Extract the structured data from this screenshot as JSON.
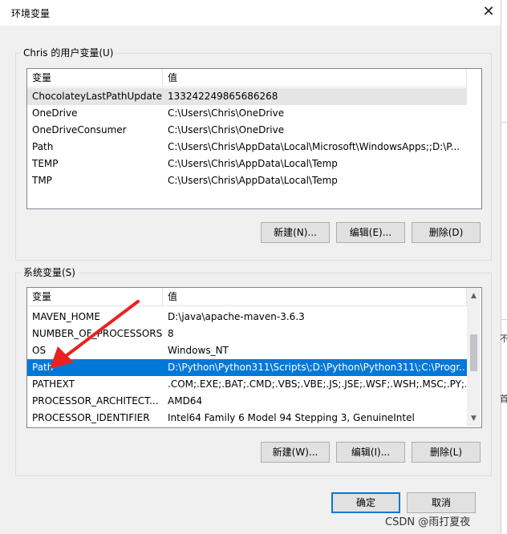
{
  "window": {
    "title": "环境变量"
  },
  "user_group": {
    "label": "Chris 的用户变量(U)",
    "columns": {
      "name": "变量",
      "value": "值"
    },
    "rows": [
      {
        "name": "ChocolateyLastPathUpdate",
        "value": "133242249865686268"
      },
      {
        "name": "OneDrive",
        "value": "C:\\Users\\Chris\\OneDrive"
      },
      {
        "name": "OneDriveConsumer",
        "value": "C:\\Users\\Chris\\OneDrive"
      },
      {
        "name": "Path",
        "value": "C:\\Users\\Chris\\AppData\\Local\\Microsoft\\WindowsApps;;D:\\P..."
      },
      {
        "name": "TEMP",
        "value": "C:\\Users\\Chris\\AppData\\Local\\Temp"
      },
      {
        "name": "TMP",
        "value": "C:\\Users\\Chris\\AppData\\Local\\Temp"
      }
    ],
    "buttons": {
      "new": "新建(N)...",
      "edit": "编辑(E)...",
      "delete": "删除(D)"
    }
  },
  "system_group": {
    "label": "系统变量(S)",
    "columns": {
      "name": "变量",
      "value": "值"
    },
    "rows": [
      {
        "name": "MAVEN_HOME",
        "value": "D:\\java\\apache-maven-3.6.3"
      },
      {
        "name": "NUMBER_OF_PROCESSORS",
        "value": "8"
      },
      {
        "name": "OS",
        "value": "Windows_NT"
      },
      {
        "name": "Path",
        "value": "D:\\Python\\Python311\\Scripts\\;D:\\Python\\Python311\\;C:\\Progr..."
      },
      {
        "name": "PATHEXT",
        "value": ".COM;.EXE;.BAT;.CMD;.VBS;.VBE;.JS;.JSE;.WSF;.WSH;.MSC;.PY;.P..."
      },
      {
        "name": "PROCESSOR_ARCHITECT...",
        "value": "AMD64"
      },
      {
        "name": "PROCESSOR_IDENTIFIER",
        "value": "Intel64 Family 6 Model 94 Stepping 3, GenuineIntel"
      }
    ],
    "buttons": {
      "new": "新建(W)...",
      "edit": "编辑(I)...",
      "delete": "删除(L)"
    }
  },
  "footer": {
    "ok": "确定",
    "cancel": "取消"
  },
  "background_fragments": {
    "a": "不",
    "b": "首"
  },
  "watermark": "CSDN @雨打夏夜",
  "colors": {
    "selection": "#0078d7",
    "annotation_arrow": "#e8231f"
  }
}
